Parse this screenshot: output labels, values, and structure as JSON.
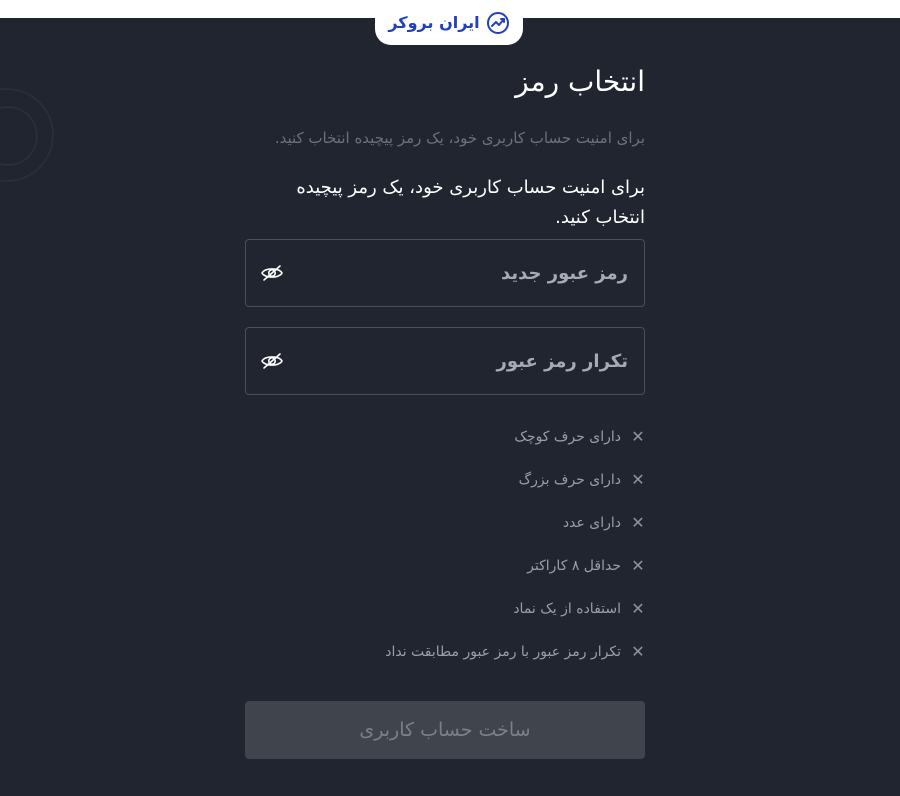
{
  "brand": {
    "logo_text": "ایران بروکر",
    "logo_color": "#1f3fbf"
  },
  "page": {
    "title": "انتخاب رمز",
    "subtitle_muted": "برای امنیت حساب کاربری خود، یک رمز پیچیده انتخاب کنید.",
    "subtitle": "برای امنیت حساب کاربری خود، یک رمز پیچیده انتخاب کنید."
  },
  "fields": {
    "new_password": {
      "placeholder": "رمز عبور جدید",
      "value": "",
      "icon": "eye-slash-icon"
    },
    "repeat_password": {
      "placeholder": "تکرار رمز عبور",
      "value": "",
      "icon": "eye-slash-icon"
    }
  },
  "rules": [
    {
      "label": "دارای حرف کوچک",
      "icon": "close-icon"
    },
    {
      "label": "دارای حرف بزرگ",
      "icon": "close-icon"
    },
    {
      "label": "دارای عدد",
      "icon": "close-icon"
    },
    {
      "label": "حداقل ۸ کاراکتر",
      "icon": "close-icon"
    },
    {
      "label": "استفاده از یک نماد",
      "icon": "close-icon"
    },
    {
      "label": "تکرار رمز عبور با رمز عبور مطابقت نداد",
      "icon": "close-icon"
    }
  ],
  "submit": {
    "label": "ساخت حساب کاربری",
    "disabled": true
  },
  "colors": {
    "background": "#202530",
    "button_disabled": "#3f444d"
  }
}
